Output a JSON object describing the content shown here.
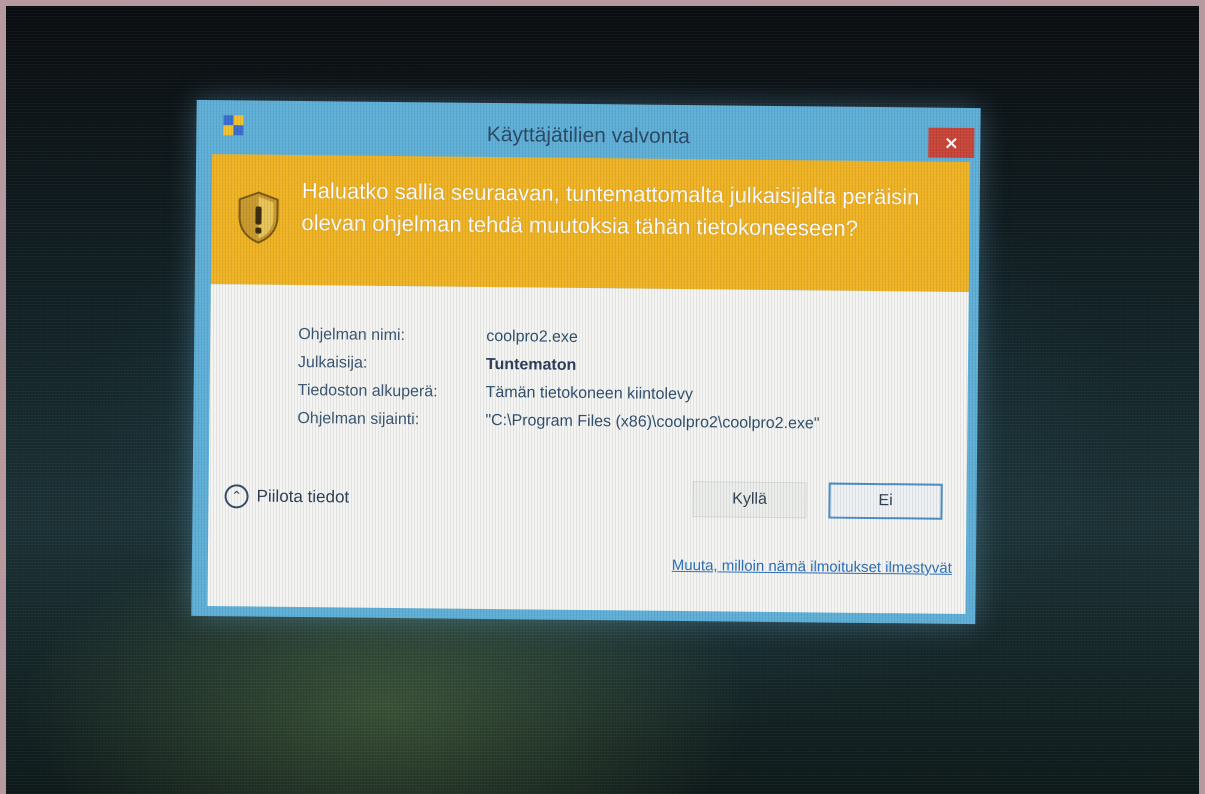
{
  "window": {
    "title": "Käyttäjätilien valvonta",
    "close_label": "×"
  },
  "banner": {
    "question": "Haluatko sallia seuraavan, tuntemattomalta julkaisijalta peräisin olevan ohjelman tehdä muutoksia tähän tietokoneeseen?",
    "icon": "uac-shield-icon"
  },
  "details": {
    "program_name_label": "Ohjelman nimi:",
    "program_name_value": "coolpro2.exe",
    "publisher_label": "Julkaisija:",
    "publisher_value": "Tuntematon",
    "origin_label": "Tiedoston alkuperä:",
    "origin_value": "Tämän tietokoneen kiintolevy",
    "location_label": "Ohjelman sijainti:",
    "location_value": "\"C:\\Program Files (x86)\\coolpro2\\coolpro2.exe\""
  },
  "actions": {
    "hide_details": "Piilota tiedot",
    "yes": "Kyllä",
    "no": "Ei",
    "change_link": "Muuta, milloin nämä ilmoitukset ilmestyvät"
  },
  "colors": {
    "banner": "#f0b324",
    "frame": "#5fb0d8",
    "close": "#c9453a",
    "link": "#2d6fb8"
  }
}
